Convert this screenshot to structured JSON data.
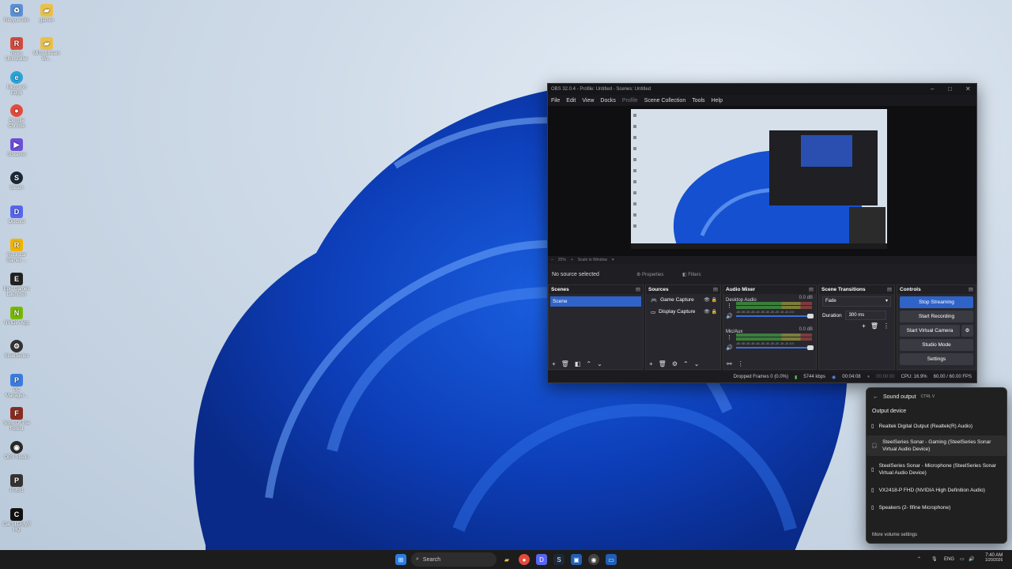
{
  "desktop": {
    "icons": [
      {
        "label": "Recycle Bin",
        "icon": "recycle-bin-icon",
        "color": "#5b8fd6"
      },
      {
        "label": "games",
        "icon": "folder-icon",
        "color": "#e8c04a"
      },
      {
        "label": "Revo Uninstaller",
        "icon": "revo-icon",
        "color": "#d24a3c"
      },
      {
        "label": "MiTo Stream Wi...",
        "icon": "folder-icon",
        "color": "#e8c04a"
      },
      {
        "label": "Microsoft Edge",
        "icon": "edge-icon",
        "color": "#2aa3d8"
      },
      {
        "label": "Google Chrome",
        "icon": "chrome-icon",
        "color": "#e24b3c"
      },
      {
        "label": "Streamio",
        "icon": "stremio-icon",
        "color": "#6b4fd8"
      },
      {
        "label": "Steam",
        "icon": "steam-icon",
        "color": "#1b2838"
      },
      {
        "label": "Discord",
        "icon": "discord-icon",
        "color": "#5865f2"
      },
      {
        "label": "Rockstar Games ...",
        "icon": "rockstar-icon",
        "color": "#f0b400"
      },
      {
        "label": "Epic Games Launcher",
        "icon": "epic-icon",
        "color": "#222222"
      },
      {
        "label": "NVIDIA App",
        "icon": "nvidia-icon",
        "color": "#76b900"
      },
      {
        "label": "SteelSeries",
        "icon": "steelseries-icon",
        "color": "#333333"
      },
      {
        "label": "PC Manager...",
        "icon": "pc-manager-icon",
        "color": "#3a7be0"
      },
      {
        "label": "Sons Of The Forest",
        "icon": "game-icon",
        "color": "#8a2b20"
      },
      {
        "label": "OBS Studio",
        "icon": "obs-icon",
        "color": "#2b2b2b"
      },
      {
        "label": "PUBG",
        "icon": "pubg-icon",
        "color": "#333333"
      },
      {
        "label": "Call of Duty® HQ",
        "icon": "cod-icon",
        "color": "#111111"
      }
    ]
  },
  "obs": {
    "title": "OBS 32.0.4 - Profile: Untitled - Scenes: Untitled",
    "menu": [
      "File",
      "Edit",
      "View",
      "Docks",
      "Profile",
      "Scene Collection",
      "Tools",
      "Help"
    ],
    "zoom": "25%",
    "scale_mode": "Scale to Window",
    "selection_status": "No source selected",
    "properties_label": "Properties",
    "filters_label": "Filters",
    "docks": {
      "scenes_title": "Scenes",
      "scenes": [
        "Scene"
      ],
      "sources_title": "Sources",
      "sources": [
        "Game Capture",
        "Display Capture"
      ],
      "mixer_title": "Audio Mixer",
      "mixer": [
        {
          "name": "Desktop Audio",
          "db": "0.0 dB"
        },
        {
          "name": "Mic/Aux",
          "db": "0.0 dB"
        }
      ],
      "meter_ticks": "-60 -55 -50 -45 -40 -35 -30 -25 -20 -15 -10 -5 0",
      "transitions_title": "Scene Transitions",
      "transition": "Fade",
      "duration_label": "Duration",
      "duration": "300 ms",
      "controls_title": "Controls",
      "controls": [
        "Stop Streaming",
        "Start Recording",
        "Start Virtual Camera",
        "Studio Mode",
        "Settings"
      ]
    },
    "status": {
      "dropped": "Dropped Frames 0 (0.0%)",
      "bitrate": "5744 kbps",
      "stream_time": "00:04:08",
      "rec_time": "00:00:00",
      "cpu": "CPU: 16.9%",
      "fps": "60.00 / 60.00 FPS"
    }
  },
  "sound_flyout": {
    "title": "Sound output",
    "shortcut": "CTRL V",
    "section": "Output device",
    "devices": [
      "Realtek Digital Output (Realtek(R) Audio)",
      "SteelSeries Sonar - Gaming (SteelSeries Sonar Virtual Audio Device)",
      "SteelSeries Sonar - Microphone (SteelSeries Sonar Virtual Audio Device)",
      "VX2418-P FHD (NVIDIA High Definition Audio)",
      "Speakers (2- fifine Microphone)"
    ],
    "more": "More volume settings"
  },
  "taskbar": {
    "search_placeholder": "Search",
    "lang": "ENG",
    "time": "7:40 AM",
    "date": "1/20/2026"
  }
}
